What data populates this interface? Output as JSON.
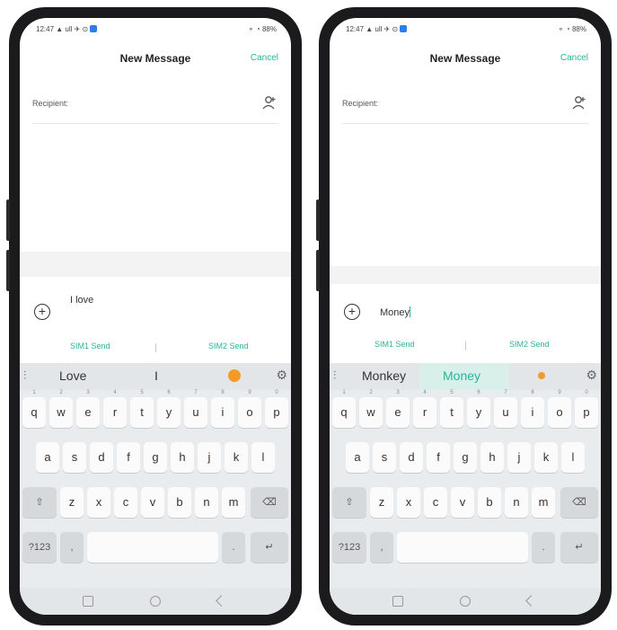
{
  "phones": [
    {
      "status_left": "12:47 ▲ ull ✈ ⊙",
      "status_right": "⚬ ◔ 88%",
      "title": "New Message",
      "cancel": "Cancel",
      "recipient_label": "Recipient:",
      "message_text": "I love",
      "sim1": "SIM1 Send",
      "sim2": "SIM2 Send",
      "suggestions": [
        "Love",
        "I"
      ],
      "highlight_suggestion": "",
      "keys_row1": [
        "q",
        "w",
        "e",
        "r",
        "t",
        "y",
        "u",
        "i",
        "o",
        "p"
      ],
      "keys_row2": [
        "a",
        "s",
        "d",
        "f",
        "g",
        "h",
        "j",
        "k",
        "l"
      ],
      "keys_row3": [
        "z",
        "x",
        "c",
        "v",
        "b",
        "n",
        "m"
      ],
      "key_123": "?123",
      "key_shift": "⇧",
      "key_delete": "⌫",
      "key_comma": ",",
      "key_period": ".",
      "key_enter": "↵"
    },
    {
      "status_left": "12:47 ▲ ull ✈ ⊙",
      "status_right": "⚬ ◔ 88%",
      "title": "New Message",
      "cancel": "Cancel",
      "recipient_label": "Recipient:",
      "message_text": "Money",
      "sim1": "SIM1 Send",
      "sim2": "SIM2 Send",
      "suggestions": [
        "Monkey"
      ],
      "highlight_suggestion": "Money",
      "keys_row1": [
        "q",
        "w",
        "e",
        "r",
        "t",
        "y",
        "u",
        "i",
        "o",
        "p"
      ],
      "keys_row2": [
        "a",
        "s",
        "d",
        "f",
        "g",
        "h",
        "j",
        "k",
        "l"
      ],
      "keys_row3": [
        "z",
        "x",
        "c",
        "v",
        "b",
        "n",
        "m"
      ],
      "key_123": "?123",
      "key_shift": "⇧",
      "key_delete": "⌫",
      "key_comma": ",",
      "key_period": ".",
      "key_enter": "↵"
    }
  ],
  "colors": {
    "accent": "#2bb39a",
    "emoji": "#f39a2b",
    "frame": "#1b1b1d"
  },
  "icons": [
    "contact-add-icon",
    "attach-plus-icon",
    "emoji-icon",
    "settings-icon"
  ]
}
